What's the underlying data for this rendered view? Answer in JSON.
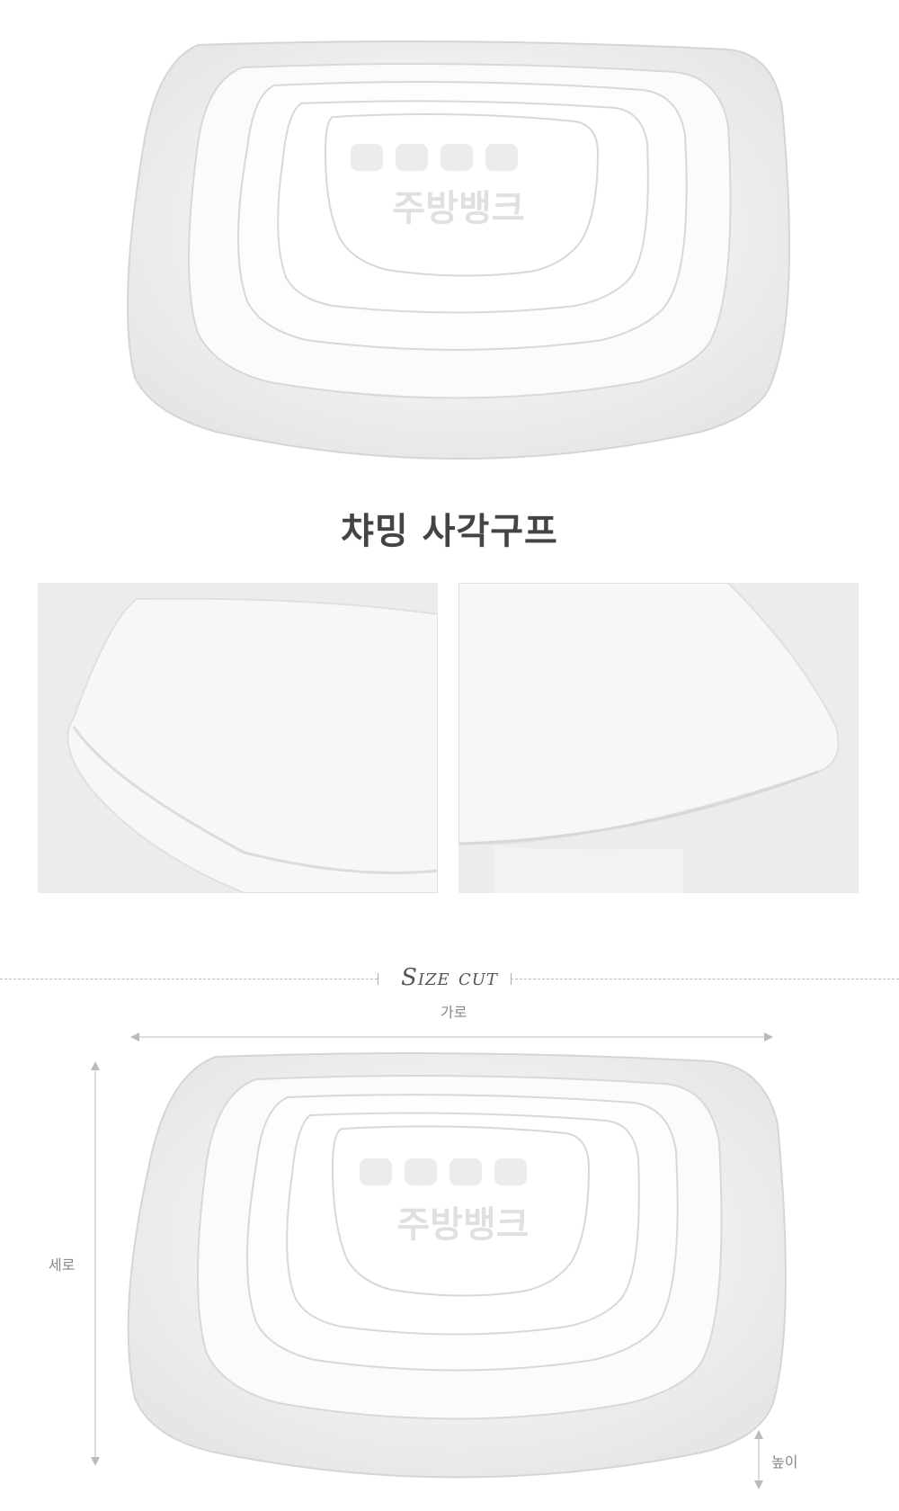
{
  "product": {
    "title": "챠밍 사각구프",
    "watermark": "주방뱅크"
  },
  "size_section": {
    "heading": "Size cut",
    "width_label": "가로",
    "length_label": "세로",
    "height_label": "높이"
  }
}
